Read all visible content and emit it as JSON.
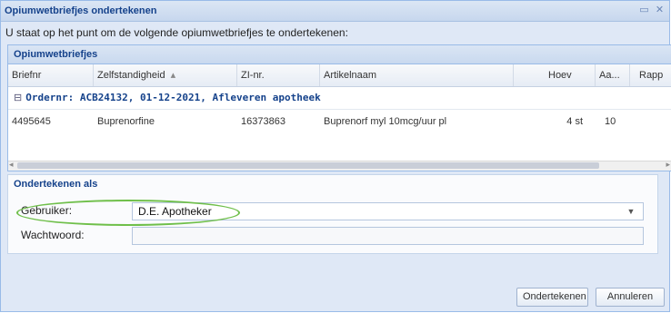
{
  "window": {
    "title": "Opiumwetbriefjes ondertekenen",
    "restore_icon": "restore-icon",
    "close_icon": "close-icon"
  },
  "prompt": "U staat op het punt om de volgende opiumwetbriefjes te ondertekenen:",
  "grid": {
    "title": "Opiumwetbriefjes",
    "columns": [
      "Briefnr",
      "Zelfstandigheid",
      "ZI-nr.",
      "Artikelnaam",
      "Hoev",
      "Aa...",
      "Rapp"
    ],
    "sort_indicator": "▴",
    "group": {
      "toggle": "⊟",
      "label": "Ordernr: ACB24132, 01-12-2021, Afleveren apotheek"
    },
    "rows": [
      {
        "briefnr": "4495645",
        "zelfstandigheid": "Buprenorfine",
        "zinr": "16373863",
        "artikelnaam": "Buprenorf myl 10mcg/uur pl",
        "hoev": "4 st",
        "aa": "10",
        "rapp": ""
      }
    ]
  },
  "sign": {
    "title": "Ondertekenen als",
    "user_label": "Gebruiker:",
    "user_value": "D.E. Apotheker",
    "password_label": "Wachtwoord:",
    "password_value": ""
  },
  "buttons": {
    "sign": "Ondertekenen",
    "cancel": "Annuleren"
  },
  "colors": {
    "highlight": "#6fbf4a",
    "title_text": "#15428b"
  }
}
